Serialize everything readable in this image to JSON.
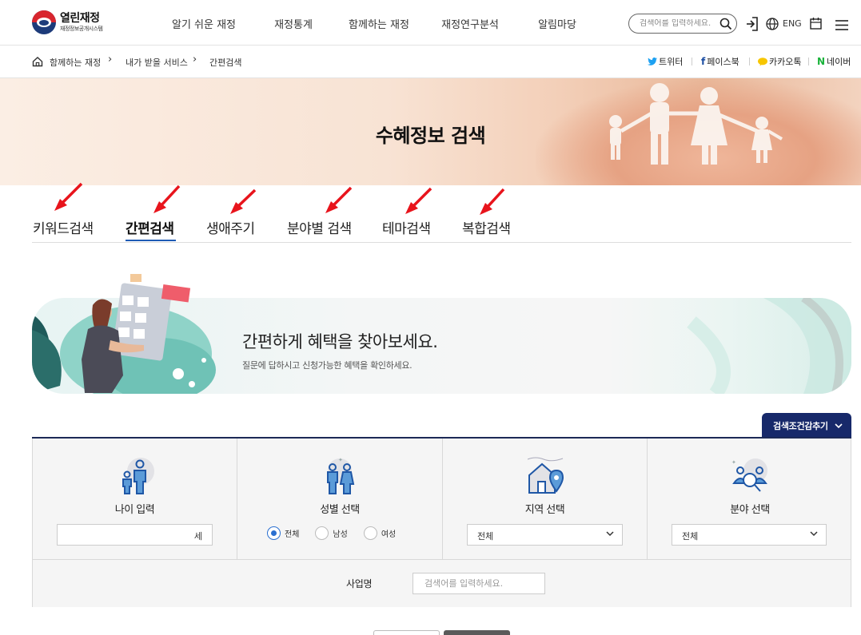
{
  "header": {
    "logo_title": "열린재정",
    "logo_subtitle": "재정정보공개시스템",
    "nav": [
      "알기 쉬운 재정",
      "재정통계",
      "함께하는 재정",
      "재정연구분석",
      "알림마당"
    ],
    "search_placeholder": "검색어를 입력하세요.",
    "lang": "ENG"
  },
  "breadcrumb": {
    "items": [
      "함께하는 재정",
      "내가 받을 서비스",
      "간편검색"
    ]
  },
  "share": {
    "twitter": "트위터",
    "facebook": "페이스북",
    "kakao": "카카오톡",
    "naver": "네이버"
  },
  "hero": {
    "title": "수혜정보 검색"
  },
  "tabs": {
    "items": [
      "키워드검색",
      "간편검색",
      "생애주기",
      "분야별 검색",
      "테마검색",
      "복합검색"
    ],
    "active": "간편검색"
  },
  "promo": {
    "title": "간편하게 혜택을 찾아보세요.",
    "subtitle": "질문에 답하시고 신청가능한 혜택을 확인하세요."
  },
  "toggle_label": "검색조건감추기",
  "filters": {
    "age": {
      "label": "나이 입력",
      "unit": "세",
      "value": ""
    },
    "gender": {
      "label": "성별 선택",
      "options": [
        "전체",
        "남성",
        "여성"
      ],
      "selected": "전체"
    },
    "region": {
      "label": "지역 선택",
      "selected": "전체"
    },
    "field": {
      "label": "분야 선택",
      "selected": "전체"
    }
  },
  "business": {
    "label": "사업명",
    "placeholder": "검색어를 입력하세요."
  },
  "colors": {
    "accent_navy": "#17296a",
    "tab_underline": "#1e5bb5",
    "radio_blue": "#2a6fd0",
    "annotation_red": "#e8141c"
  }
}
